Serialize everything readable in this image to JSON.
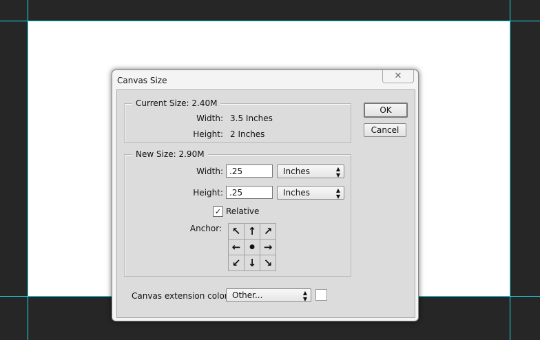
{
  "dialog": {
    "title": "Canvas Size",
    "close": "✕",
    "current": {
      "legend": "Current Size: 2.40M",
      "width_label": "Width:",
      "width_value": "3.5 Inches",
      "height_label": "Height:",
      "height_value": "2 Inches"
    },
    "new": {
      "legend": "New Size: 2.90M",
      "width_label": "Width:",
      "width_value": ".25",
      "width_unit": "Inches",
      "height_label": "Height:",
      "height_value": ".25",
      "height_unit": "Inches",
      "relative_label": "Relative",
      "relative_checked": true,
      "anchor_label": "Anchor:",
      "anchor_arrows": [
        "↖",
        "↑",
        "↗",
        "←",
        "●",
        "→",
        "↙",
        "↓",
        "↘"
      ]
    },
    "ok": "OK",
    "cancel": "Cancel",
    "ext_label": "Canvas extension color:",
    "ext_value": "Other...",
    "ext_color": "#ffffff"
  }
}
